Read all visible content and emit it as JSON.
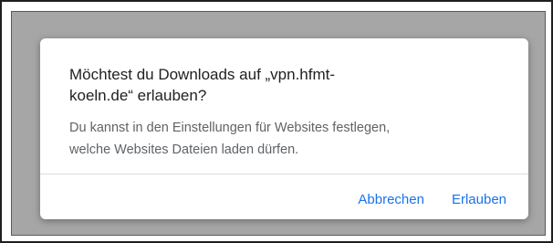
{
  "dialog": {
    "title_line1": "Möchtest du Downloads auf „vpn.hfmt-",
    "title_line2": "koeln.de“ erlauben?",
    "message_line1": "Du kannst in den Einstellungen für Websites festlegen,",
    "message_line2": "welche Websites Dateien laden dürfen.",
    "cancel_label": "Abbrechen",
    "allow_label": "Erlauben"
  },
  "colors": {
    "accent": "#1a73e8",
    "backdrop": "#a6a6a6",
    "title_text": "#202124",
    "body_text": "#5f6368"
  }
}
